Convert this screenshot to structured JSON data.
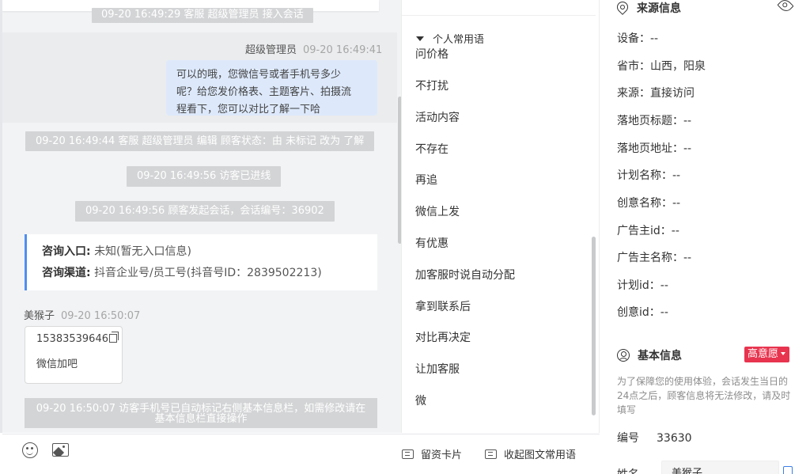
{
  "chat": {
    "sys_agent_joined": "09-20 16:49:29 客服 超级管理员 接入会话",
    "agent_name": "超级管理员",
    "agent_time": "09-20 16:49:41",
    "agent_message_lines": [
      "可以的哦，您微信号或者手机号多少",
      "呢？给您发价格表、主题客片、拍摄流",
      "程看下，您可以对比了解一下哈"
    ],
    "sys_status_change": "09-20 16:49:44 客服 超级管理员 编辑 顾客状态：由 未标记 改为 了解",
    "sys_visitor_entered": "09-20 16:49:56 访客已进线",
    "sys_session_started": "09-20 16:49:56 顾客发起会话，会话编号：36902",
    "info_card": {
      "entry_label": "咨询入口:",
      "entry_value": "未知(暂无入口信息)",
      "channel_label": "咨询渠道:",
      "channel_value": "抖音企业号/员工号(抖音号ID：2839502213)"
    },
    "visitor_name": "美猴子",
    "visitor_time": "09-20 16:50:07",
    "visitor_phone": "15383539646",
    "visitor_text": "微信加吧",
    "sys_auto_mark_line1": "09-20 16:50:07 访客手机号已自动标记右侧基本信息栏，如需修改请在",
    "sys_auto_mark_line2": "基本信息栏直接操作"
  },
  "toolbar": {
    "emoji_icon": "emoji-icon",
    "image_icon": "image-icon",
    "lead_card_label": "留资卡片",
    "collapse_phrases_label": "收起图文常用语"
  },
  "phrases": {
    "group_label": "个人常用语",
    "items": [
      "问价格",
      "不打扰",
      "活动内容",
      "不存在",
      "再追",
      "微信上发",
      "有优惠",
      "加客服时说自动分配",
      "拿到联系后",
      "对比再决定",
      "让加客服",
      "微"
    ]
  },
  "source_info": {
    "title": "来源信息",
    "fields": [
      "设备：--",
      "省市：山西，阳泉",
      "来源：直接访问",
      "落地页标题：--",
      "落地页地址：--",
      "计划名称：--",
      "创意名称：--",
      "广告主id：--",
      "广告主名称：--",
      "计划id：--",
      "创意id：--"
    ]
  },
  "basic_info": {
    "title": "基本信息",
    "intent_badge": "高意愿",
    "hint": "为了保障您的使用体验，会话发生当日的24点之后，顾客信息将无法修改，请及时填写",
    "id_label": "编号",
    "id_value": "33630",
    "name_label": "姓名",
    "name_value": "美猴子"
  },
  "colors": {
    "accent_blue": "#4f8ff0",
    "agent_bubble": "#dde9fb",
    "system_pill": "#d3d4d6",
    "intent_badge": "#e8344e"
  }
}
